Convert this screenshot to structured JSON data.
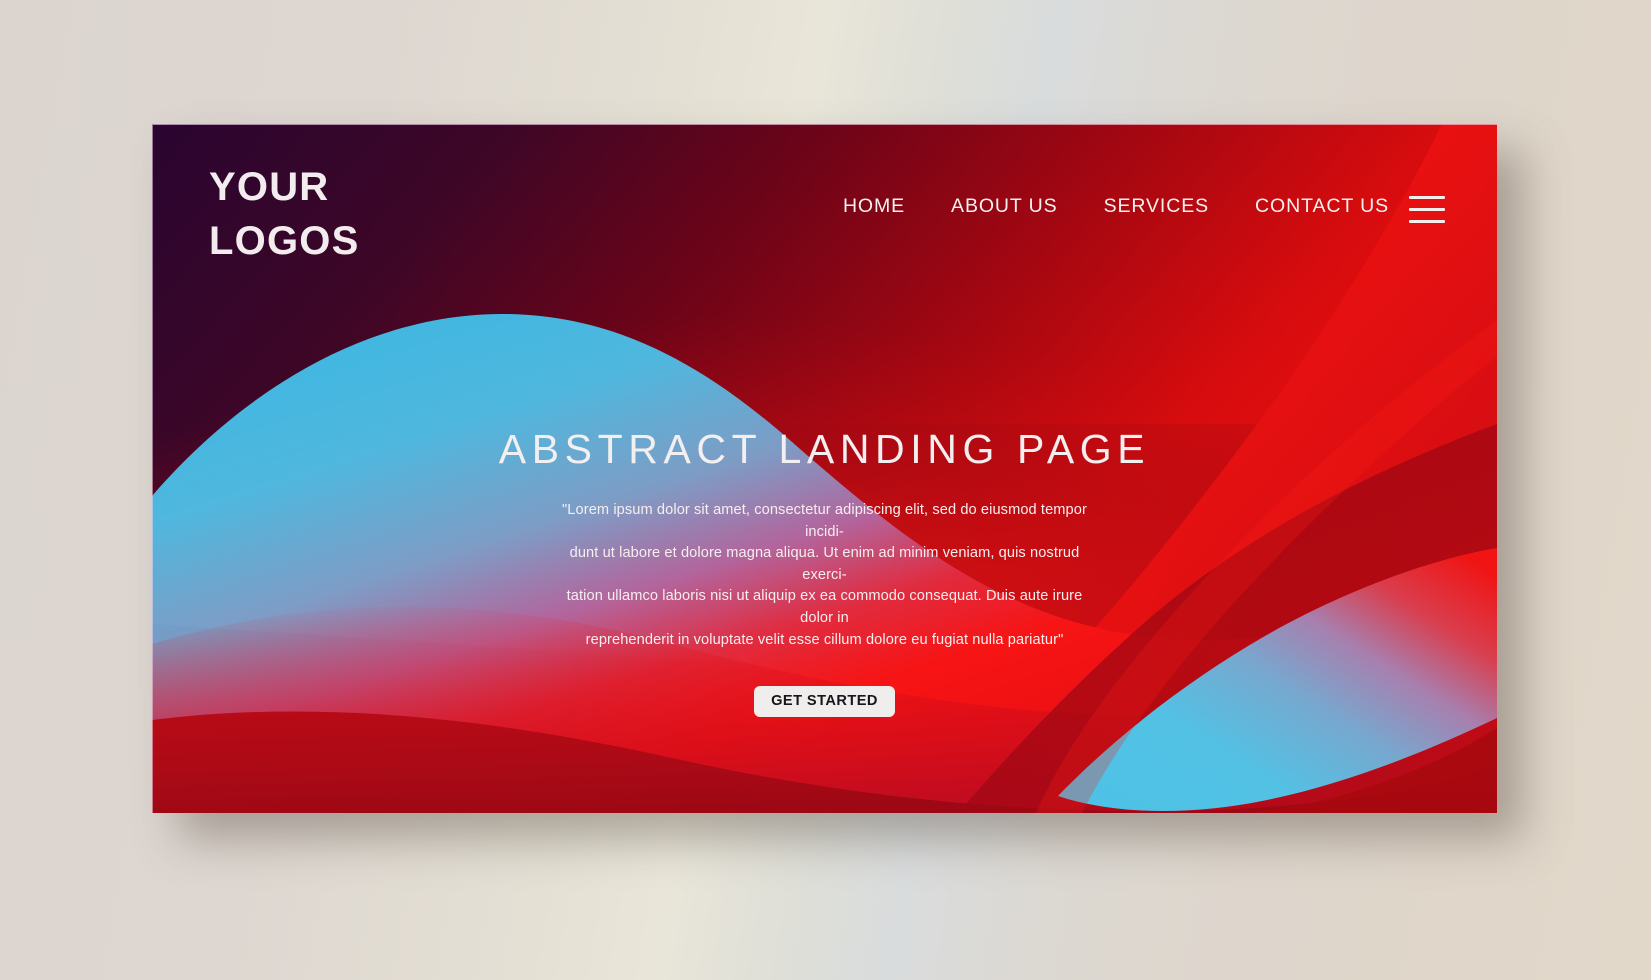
{
  "page": {
    "canvas_background": "#dcd5cf",
    "card": {
      "shadow_color": "rgba(90,78,70,0.42)",
      "base_dark": "#2a0530"
    }
  },
  "brand": {
    "logo_line1": "YOUR",
    "logo_line2": "LOGOS",
    "logo_color": "#f2ecee"
  },
  "nav": {
    "items": [
      {
        "label": "HOME"
      },
      {
        "label": "ABOUT US"
      },
      {
        "label": "SERVICES"
      },
      {
        "label": "CONTACT US"
      }
    ],
    "menu_icon": "hamburger-icon"
  },
  "hero": {
    "title": "ABSTRACT LANDING PAGE",
    "paragraph_lines": [
      "\"Lorem ipsum dolor sit amet, consectetur adipiscing elit, sed do eiusmod tempor incidi-",
      "dunt ut labore et dolore magna aliqua. Ut enim ad minim veniam, quis nostrud exerci-",
      "tation ullamco laboris nisi ut aliquip ex ea commodo consequat. Duis aute irure dolor in",
      "reprehenderit in voluptate velit esse cillum dolore eu fugiat nulla pariatur\""
    ],
    "cta_label": "GET STARTED",
    "cta_background": "#efeeec",
    "cta_text_color": "#17161a"
  },
  "palette": {
    "dark_purple": "#2a0530",
    "deep_maroon": "#6e0419",
    "crimson": "#b80b17",
    "bright_red": "#f20d0d",
    "scarlet": "#ef1212",
    "cyan": "#3fb8e2",
    "sky_blue": "#55c2e6",
    "off_white": "#f3eeef"
  }
}
